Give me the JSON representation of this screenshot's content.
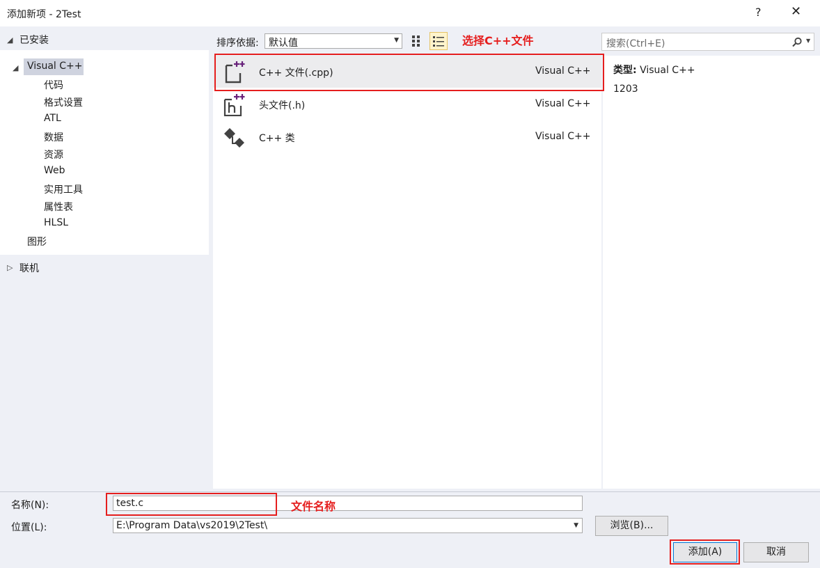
{
  "window": {
    "title": "添加新项 - 2Test",
    "help_glyph": "?",
    "close_glyph": "✕"
  },
  "tree": {
    "installed": "已安装",
    "visual_cpp": "Visual C++",
    "children": [
      "代码",
      "格式设置",
      "ATL",
      "数据",
      "资源",
      "Web",
      "实用工具",
      "属性表",
      "HLSL"
    ],
    "graphics": "图形",
    "online": "联机"
  },
  "toolbar": {
    "sort_label": "排序依据:",
    "sort_value": "默认值",
    "search_placeholder": "搜索(Ctrl+E)"
  },
  "templates": [
    {
      "name": "C++ 文件(.cpp)",
      "language": "Visual C++",
      "icon": "cpp-file-icon",
      "selected": true
    },
    {
      "name": "头文件(.h)",
      "language": "Visual C++",
      "icon": "header-file-icon",
      "selected": false
    },
    {
      "name": "C++ 类",
      "language": "Visual C++",
      "icon": "cpp-class-icon",
      "selected": false
    }
  ],
  "details": {
    "type_label": "类型:",
    "type_value": "Visual C++",
    "number": "1203"
  },
  "form": {
    "name_label": "名称(N):",
    "name_value": "test.c",
    "location_label": "位置(L):",
    "location_value": "E:\\Program Data\\vs2019\\2Test\\",
    "browse_label": "浏览(B)...",
    "add_label": "添加(A)",
    "cancel_label": "取消"
  },
  "annotations": {
    "select_cpp": "选择C++文件",
    "file_name": "文件名称"
  },
  "colors": {
    "annotation": "#e51e1e",
    "accent_purple": "#68217a"
  }
}
